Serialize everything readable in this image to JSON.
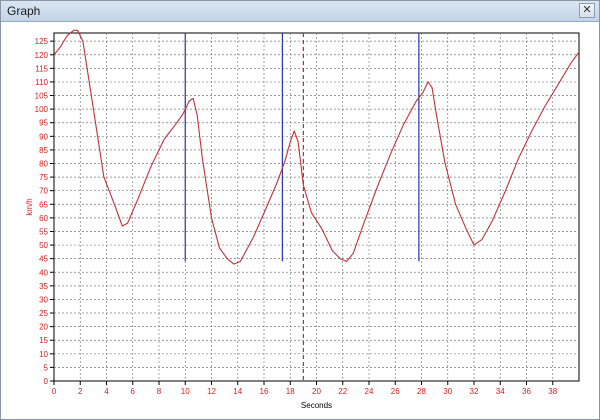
{
  "window": {
    "title": "Graph",
    "close_icon": "close-icon"
  },
  "chart_data": {
    "type": "line",
    "xlabel": "Seconds",
    "ylabel": "km/h",
    "xlim": [
      0,
      40
    ],
    "ylim": [
      0,
      128
    ],
    "x_ticks": [
      0,
      2,
      4,
      6,
      8,
      10,
      12,
      14,
      16,
      18,
      20,
      22,
      24,
      26,
      28,
      30,
      32,
      34,
      36,
      38
    ],
    "y_ticks": [
      0,
      5,
      10,
      15,
      20,
      25,
      30,
      35,
      40,
      45,
      50,
      55,
      60,
      65,
      70,
      75,
      80,
      85,
      90,
      95,
      100,
      105,
      110,
      115,
      120,
      125
    ],
    "grid": true,
    "colors": {
      "line": "#c0323a",
      "markers": "#2833b8",
      "cursor": "#b03030",
      "axis_text": "#d21e1e",
      "grid": "#7c7c7c"
    },
    "series": [
      {
        "color": "#c0323a",
        "x": [
          0,
          0.5,
          1.0,
          1.5,
          1.8,
          2.2,
          3.0,
          3.8,
          4.6,
          5.2,
          5.6,
          6.4,
          7.4,
          8.4,
          9.2,
          9.8,
          10.3,
          10.6,
          10.9,
          11.3,
          12.0,
          12.6,
          13.2,
          13.7,
          14.2,
          15.2,
          16.2,
          17.0,
          17.6,
          18.0,
          18.3,
          18.6,
          19.0,
          19.6,
          20.4,
          21.2,
          21.8,
          22.3,
          22.8,
          23.6,
          24.6,
          25.6,
          26.6,
          27.6,
          28.1,
          28.5,
          28.8,
          29.2,
          29.8,
          30.6,
          31.4,
          32.0,
          32.6,
          33.4,
          34.4,
          35.4,
          36.4,
          37.4,
          38.4,
          39.4,
          40.0
        ],
        "y": [
          120,
          123,
          127,
          129,
          129,
          125,
          100,
          75,
          65,
          57,
          58,
          67,
          79,
          89,
          94,
          98,
          103,
          104,
          98,
          82,
          60,
          49,
          45,
          43,
          44,
          53,
          64,
          73,
          81,
          88,
          92,
          88,
          72,
          62,
          56,
          48,
          45,
          44,
          47,
          58,
          71,
          83,
          94,
          103,
          106,
          110,
          108,
          96,
          80,
          65,
          56,
          50,
          52,
          59,
          70,
          82,
          92,
          101,
          109,
          117,
          121
        ]
      }
    ],
    "markers_x": [
      10,
      17.4,
      27.8
    ],
    "cursor_x": 19
  }
}
